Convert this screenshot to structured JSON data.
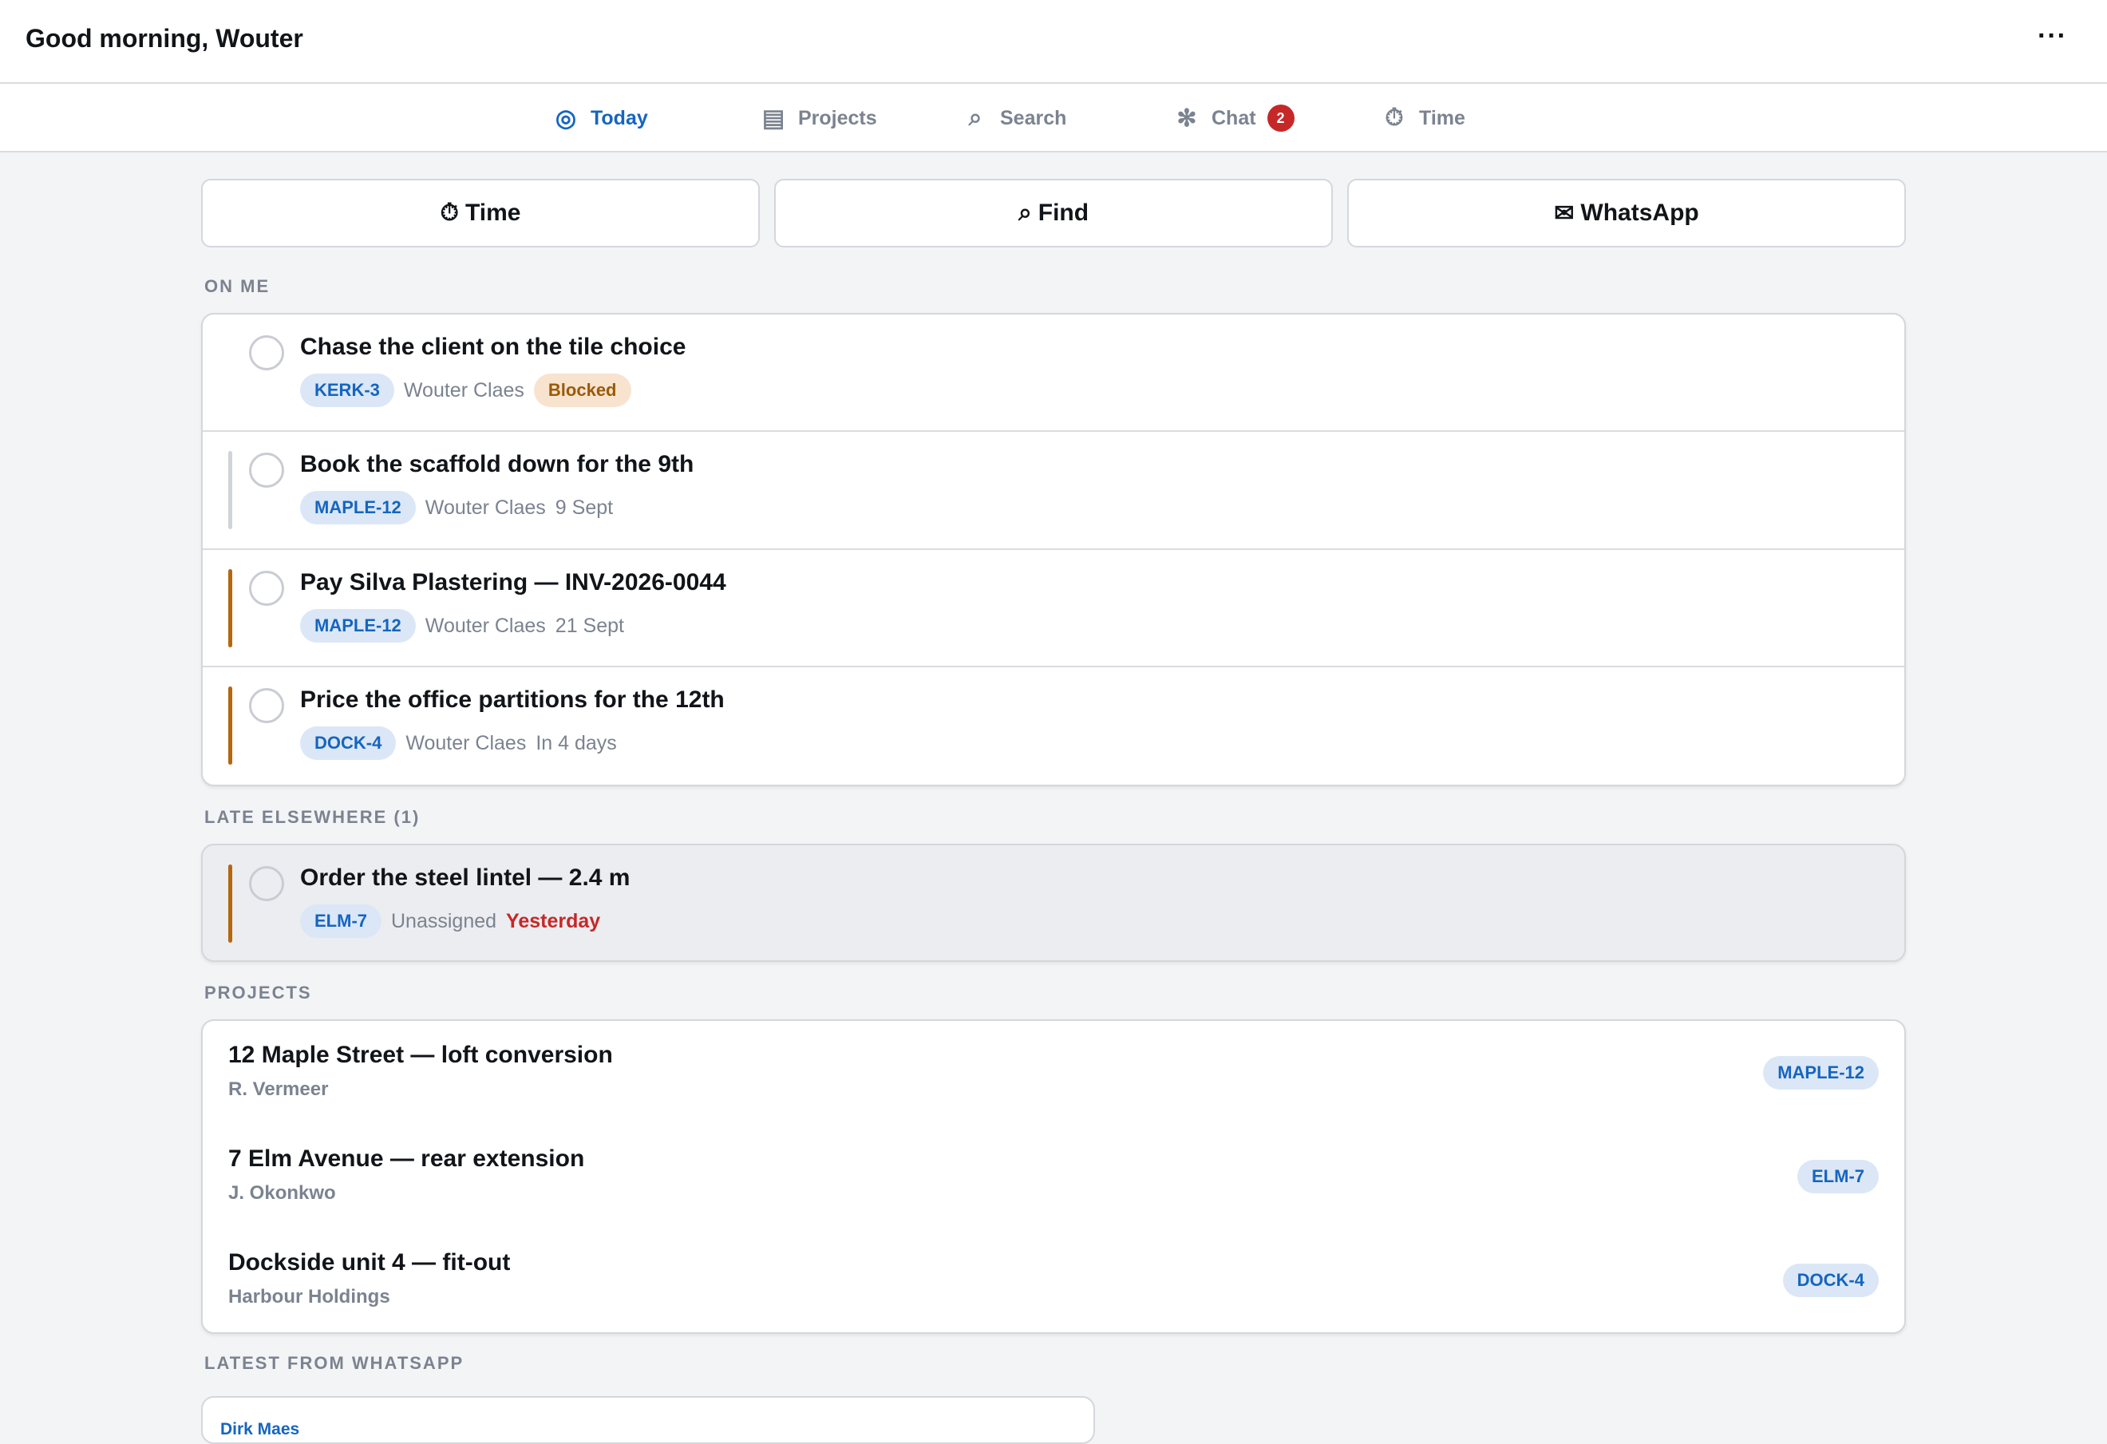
{
  "header": {
    "greeting": "Good morning, Wouter",
    "more": "···"
  },
  "tabs": [
    {
      "icon": "◎",
      "label": "Today"
    },
    {
      "icon": "▤",
      "label": "Projects"
    },
    {
      "icon": "⌕",
      "label": "Search"
    },
    {
      "icon": "✻",
      "label": "Chat",
      "badge": "2"
    },
    {
      "icon": "⏱",
      "label": "Time"
    }
  ],
  "actions": [
    {
      "icon": "⏱",
      "label": "Time"
    },
    {
      "icon": "⌕",
      "label": "Find"
    },
    {
      "icon": "✉",
      "label": "WhatsApp"
    }
  ],
  "sections": {
    "on_me": "ON ME",
    "late_elsewhere": "LATE ELSEWHERE (1)",
    "projects": "PROJECTS",
    "whatsapp": "LATEST FROM WHATSAPP"
  },
  "colors": {
    "accent": "#1565c0",
    "bar_neutral": "#d0d3d8",
    "bar_due": "#b5670e",
    "late": "#c62828"
  },
  "on_me_tasks": [
    {
      "title": "Chase the client on the tile choice",
      "project": "KERK-3",
      "assignee": "Wouter Claes",
      "status": "Blocked"
    },
    {
      "title": "Book the scaffold down for the 9th",
      "project": "MAPLE-12",
      "assignee": "Wouter Claes",
      "due": "9 Sept"
    },
    {
      "title": "Pay Silva Plastering — INV-2026-0044",
      "project": "MAPLE-12",
      "assignee": "Wouter Claes",
      "due": "21 Sept"
    },
    {
      "title": "Price the office partitions for the 12th",
      "project": "DOCK-4",
      "assignee": "Wouter Claes",
      "due": "In 4 days"
    }
  ],
  "late_tasks": [
    {
      "title": "Order the steel lintel — 2.4 m",
      "project": "ELM-7",
      "assignee": "Unassigned",
      "due": "Yesterday"
    }
  ],
  "projects": [
    {
      "title": "12 Maple Street — loft conversion",
      "client": "R. Vermeer",
      "code": "MAPLE-12"
    },
    {
      "title": "7 Elm Avenue — rear extension",
      "client": "J. Okonkwo",
      "code": "ELM-7"
    },
    {
      "title": "Dockside unit 4 — fit-out",
      "client": "Harbour Holdings",
      "code": "DOCK-4"
    }
  ],
  "whatsapp": [
    {
      "sender": "Dirk Maes"
    }
  ]
}
